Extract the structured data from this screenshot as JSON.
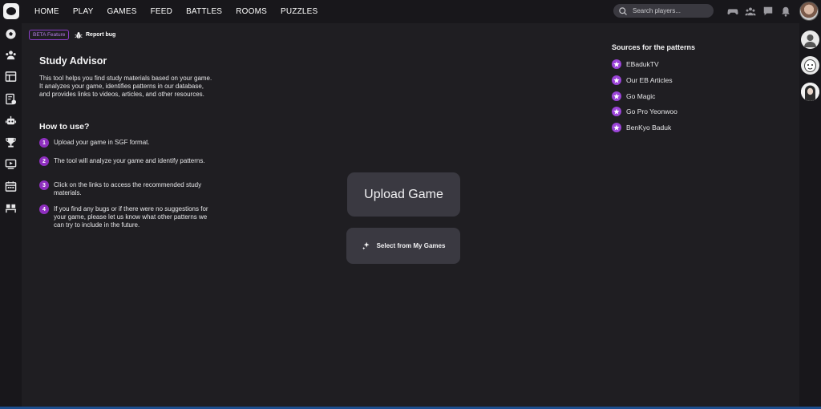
{
  "nav": {
    "items": [
      "HOME",
      "PLAY",
      "GAMES",
      "FEED",
      "BATTLES",
      "ROOMS",
      "PUZZLES"
    ],
    "search_placeholder": "Search players..."
  },
  "header": {
    "beta_badge": "BETA Feature",
    "report_bug": "Report bug"
  },
  "advisor": {
    "title": "Study Advisor",
    "description": "This tool helps you find study materials based on your game. It analyzes your game, identifies patterns in our database, and provides links to videos, articles, and other resources.",
    "how_title": "How to use?",
    "steps": [
      {
        "num": "1",
        "text": "Upload your game in SGF format."
      },
      {
        "num": "2",
        "text": "The tool will analyze your game and identify patterns."
      },
      {
        "num": "3",
        "text": "Click on the links to access the recommended study materials."
      },
      {
        "num": "4",
        "text": "If you find any bugs or if there were no suggestions for your game, please let us know what other patterns we can try to include in the future."
      }
    ]
  },
  "actions": {
    "upload": "Upload Game",
    "select": "Select from My Games"
  },
  "sources": {
    "title": "Sources for the patterns",
    "items": [
      "EBadukTV",
      "Our EB Articles",
      "Go Magic",
      "Go Pro Yeonwoo",
      "BenKyo Baduk"
    ]
  },
  "colors": {
    "accent": "#8e2fbf",
    "background": "#1f1e22",
    "sidebar": "#18171b",
    "button": "#3a3941"
  }
}
